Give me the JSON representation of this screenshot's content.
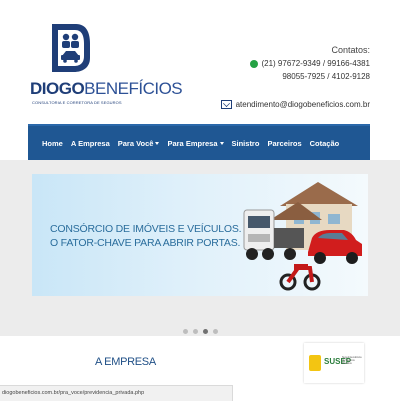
{
  "brand": {
    "name_bold": "DIOGO",
    "name_light": "BENEFÍCIOS",
    "tagline": "CONSULTORIA E CORRETORA DE SEGUROS",
    "color_primary": "#1f3e78"
  },
  "contacts": {
    "title": "Contatos:",
    "phone_line1": "(21) 97672-9349 / 99166-4381",
    "phone_line2": "98055-7925 / 4102-9128",
    "email": "atendimento@diogobeneficios.com.br"
  },
  "nav": {
    "items": [
      {
        "label": "Home",
        "has_caret": false
      },
      {
        "label": "A Empresa",
        "has_caret": false
      },
      {
        "label": "Para Você",
        "has_caret": true
      },
      {
        "label": "Para Empresa",
        "has_caret": true
      },
      {
        "label": "Sinistro",
        "has_caret": false
      },
      {
        "label": "Parceiros",
        "has_caret": false
      },
      {
        "label": "Cotação",
        "has_caret": false
      }
    ],
    "color": "#1f5793"
  },
  "slider": {
    "line1": "CONSÓRCIO DE IMÓVEIS E VEÍCULOS.",
    "line2": "O FATOR-CHAVE PARA ABRIR PORTAS.",
    "dots_count": 4,
    "active_dot": 2
  },
  "section": {
    "title": "A EMPRESA"
  },
  "partner": {
    "name": "SUSEP",
    "subtitle": "Superintendência de Seguros Privados"
  },
  "status_bar": {
    "url": "diogobeneficios.com.br/pra_voce/previdencia_privada.php"
  }
}
